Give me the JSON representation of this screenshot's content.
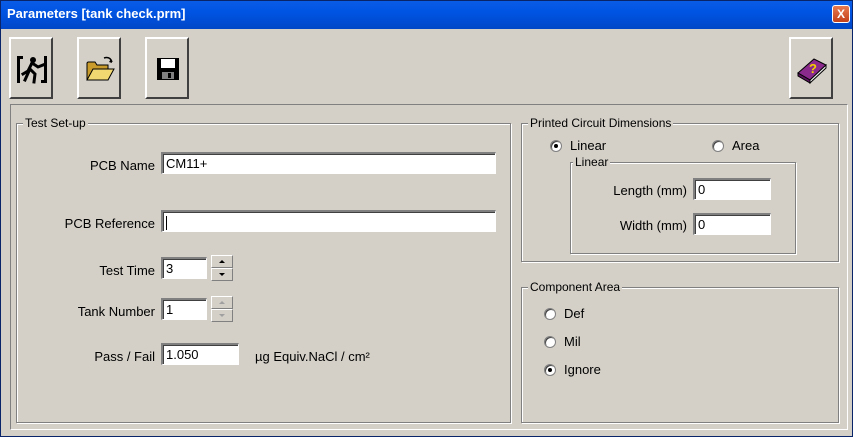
{
  "window": {
    "title": "Parameters [tank check.prm]",
    "close_glyph": "X"
  },
  "toolbar": {
    "exit_icon": "exit-icon",
    "open_icon": "open-folder-icon",
    "save_icon": "save-disk-icon",
    "help_icon": "help-book-icon"
  },
  "test_setup": {
    "title": "Test Set-up",
    "pcb_name_label": "PCB Name",
    "pcb_name_value": "CM11+",
    "pcb_reference_label": "PCB Reference",
    "pcb_reference_value": "",
    "test_time_label": "Test Time",
    "test_time_value": "3",
    "tank_number_label": "Tank Number",
    "tank_number_value": "1",
    "pass_fail_label": "Pass / Fail",
    "pass_fail_value": "1.050",
    "pass_fail_unit": "µg Equiv.NaCl / cm²"
  },
  "pcd": {
    "title": "Printed Circuit Dimensions",
    "radio_linear": "Linear",
    "radio_area": "Area",
    "selected": "Linear",
    "linear_group_title": "Linear",
    "length_label": "Length (mm)",
    "length_value": "0",
    "width_label": "Width (mm)",
    "width_value": "0"
  },
  "component_area": {
    "title": "Component Area",
    "options": [
      "Def",
      "Mil",
      "Ignore"
    ],
    "selected": "Ignore"
  }
}
